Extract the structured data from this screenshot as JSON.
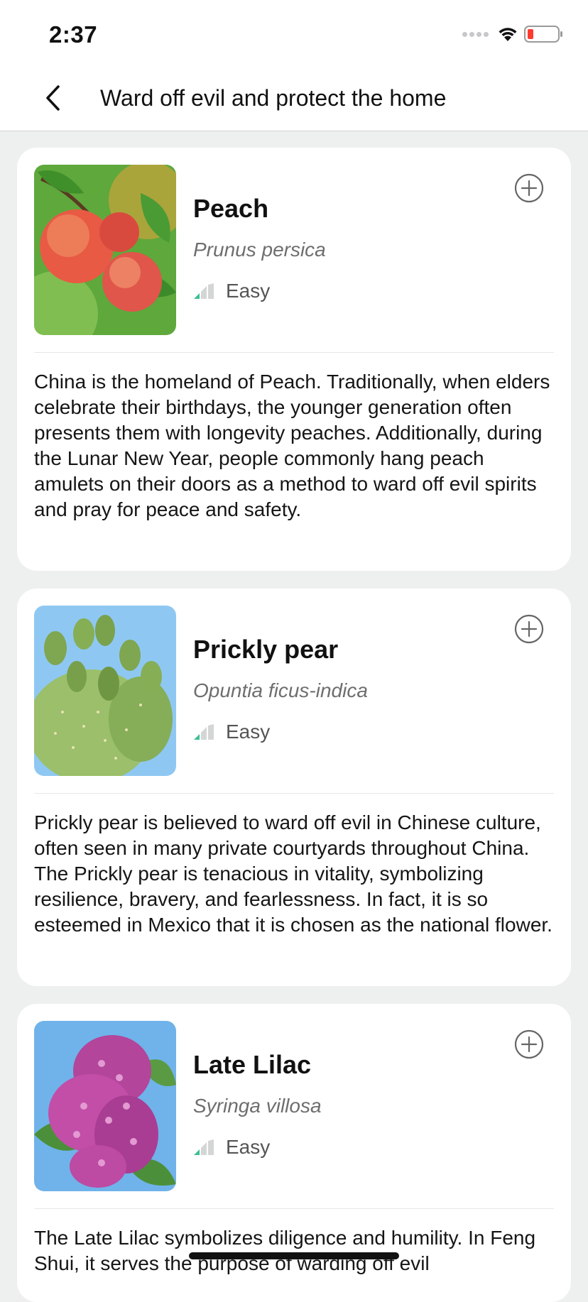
{
  "status_bar": {
    "time": "2:37"
  },
  "nav": {
    "title": "Ward off evil and protect the home"
  },
  "plants": [
    {
      "name": "Peach",
      "scientific_name": "Prunus persica",
      "difficulty": "Easy",
      "description": "China is the homeland of Peach. Traditionally, when elders celebrate their birthdays, the younger generation often presents them with longevity peaches. Additionally, during the Lunar New Year, people commonly hang peach amulets on their doors as a method to ward off evil spirits and pray for peace and safety."
    },
    {
      "name": "Prickly pear",
      "scientific_name": "Opuntia ficus-indica",
      "difficulty": "Easy",
      "description": "Prickly pear is believed to ward off evil in Chinese culture, often seen in many private courtyards throughout China. The Prickly pear is tenacious in vitality, symbolizing resilience, bravery, and fearlessness. In fact, it is so esteemed in Mexico that it is chosen as the national flower."
    },
    {
      "name": "Late Lilac",
      "scientific_name": "Syringa villosa",
      "difficulty": "Easy",
      "description": "The Late Lilac symbolizes diligence and humility. In Feng Shui, it serves the purpose of warding off evil"
    }
  ],
  "colors": {
    "difficulty_active": "#3dbf92",
    "difficulty_inactive": "#d4d6d5",
    "battery_low": "#ff3b30"
  }
}
